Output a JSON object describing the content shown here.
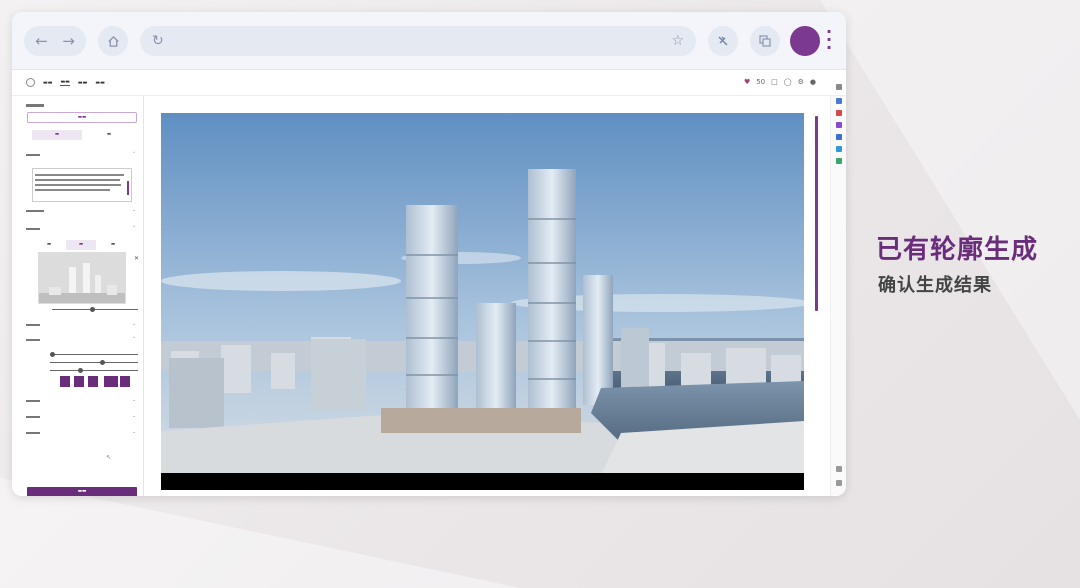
{
  "colors": {
    "accent": "#6a2d7b",
    "caption_sub": "#444444"
  },
  "caption": {
    "title": "已有轮廓生成",
    "subtitle": "确认生成结果"
  },
  "header": {
    "credits": "50"
  },
  "icons": [
    "back-arrow-icon",
    "forward-arrow-icon",
    "home-icon",
    "reload-icon",
    "star-icon",
    "extension-icon",
    "translate-icon",
    "kebab-menu-icon",
    "heart-icon"
  ]
}
